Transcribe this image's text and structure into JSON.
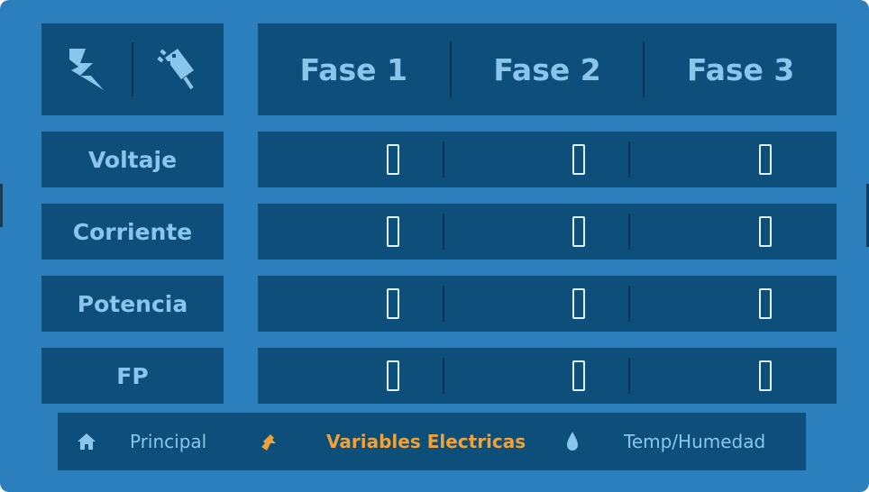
{
  "header": {
    "icons": [
      "lightning-bolt-icon",
      "power-plug-icon"
    ],
    "phases": [
      "Fase 1",
      "Fase 2",
      "Fase 3"
    ]
  },
  "rows": [
    {
      "label": "Voltaje",
      "values": [
        "0",
        "0",
        "0"
      ]
    },
    {
      "label": "Corriente",
      "values": [
        "0",
        "0",
        "0"
      ]
    },
    {
      "label": "Potencia",
      "values": [
        "0",
        "0",
        "0"
      ]
    },
    {
      "label": "FP",
      "values": [
        "0",
        "0",
        "0"
      ]
    }
  ],
  "nav": {
    "items": [
      {
        "label": "Principal",
        "icon": "home-icon"
      },
      {
        "label": "Variables Electricas",
        "icon": "electric-plug-icon",
        "active": true
      },
      {
        "label": "Temp/Humedad",
        "icon": "water-drop-icon"
      }
    ]
  },
  "colors": {
    "background": "#2b7fbd",
    "panel": "#0d4e7b",
    "label": "#8ac5ec",
    "active": "#f0a23a",
    "digit": "#dff1ff"
  }
}
